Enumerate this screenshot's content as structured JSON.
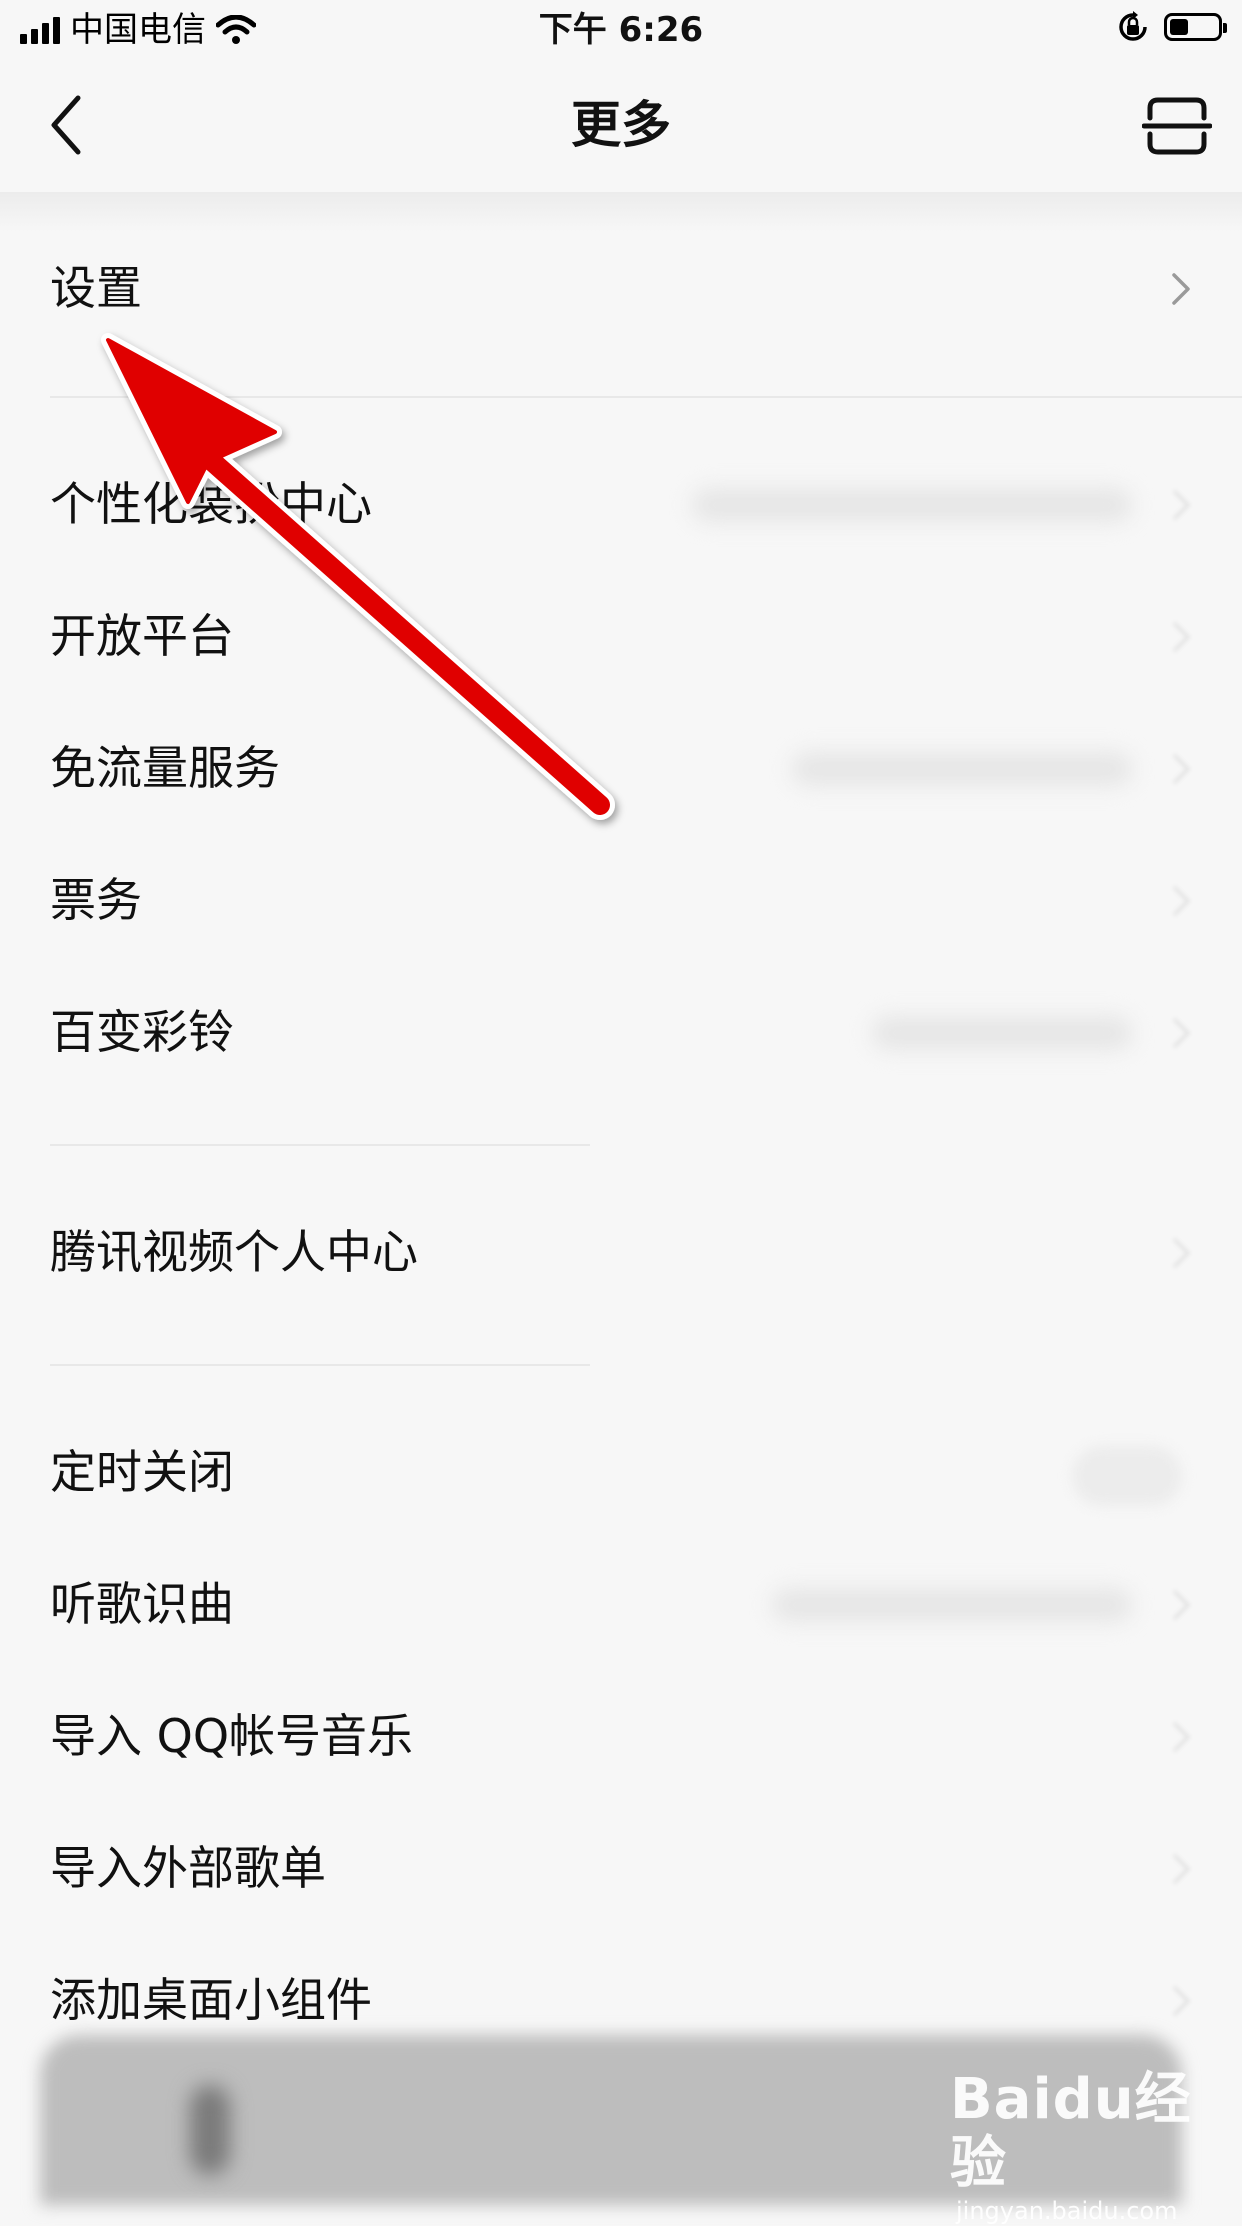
{
  "status_bar": {
    "carrier": "中国电信",
    "time": "下午 6:26",
    "icons": [
      "signal-icon",
      "wifi-icon",
      "rotation-lock-icon",
      "battery-icon"
    ]
  },
  "nav": {
    "title": "更多",
    "back_icon": "back-chevron-icon",
    "scan_icon": "scan-icon"
  },
  "menu": {
    "items": [
      {
        "label": "设置"
      },
      {
        "label": "个性化装扮中心"
      },
      {
        "label": "开放平台"
      },
      {
        "label": "免流量服务"
      },
      {
        "label": "票务"
      },
      {
        "label": "百变彩铃"
      },
      {
        "label": "腾讯视频个人中心"
      },
      {
        "label": "定时关闭"
      },
      {
        "label": "听歌识曲"
      },
      {
        "label": "导入 QQ帐号音乐"
      },
      {
        "label": "导入外部歌单"
      },
      {
        "label": "添加桌面小组件"
      }
    ]
  },
  "annotation": {
    "arrow_color": "#e00000"
  },
  "watermark": {
    "logo": "Baidu经验",
    "url": "jingyan.baidu.com"
  }
}
